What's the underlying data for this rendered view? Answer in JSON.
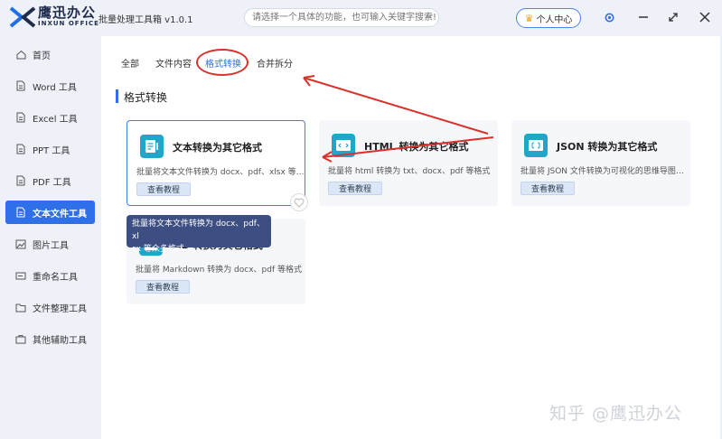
{
  "app": {
    "brand_cn": "鹰迅办公",
    "brand_en": "INXUN OFFICE",
    "title": "批量处理工具箱 v1.0.1"
  },
  "search": {
    "placeholder": "请选择一个具体的功能，也可输入关键字搜索!"
  },
  "header": {
    "user_center": "个人中心"
  },
  "sidebar": {
    "items": [
      {
        "label": "首页",
        "icon": "home-icon"
      },
      {
        "label": "Word 工具",
        "icon": "document-icon"
      },
      {
        "label": "Excel 工具",
        "icon": "document-icon"
      },
      {
        "label": "PPT 工具",
        "icon": "document-icon"
      },
      {
        "label": "PDF 工具",
        "icon": "document-icon"
      },
      {
        "label": "文本文件工具",
        "icon": "document-icon",
        "active": true
      },
      {
        "label": "图片工具",
        "icon": "image-icon"
      },
      {
        "label": "重命名工具",
        "icon": "rename-icon"
      },
      {
        "label": "文件整理工具",
        "icon": "folder-icon"
      },
      {
        "label": "其他辅助工具",
        "icon": "toolbox-icon"
      }
    ]
  },
  "tabs": [
    {
      "label": "全部"
    },
    {
      "label": "文件内容"
    },
    {
      "label": "格式转换",
      "active": true
    },
    {
      "label": "合并拆分"
    }
  ],
  "section": {
    "title": "格式转换"
  },
  "cards": [
    {
      "title": "文本转换为其它格式",
      "desc": "批量将文本文件转换为 docx、pdf、xlsx 等…",
      "button": "查看教程"
    },
    {
      "title": "HTML 转换为其它格式",
      "desc": "批量将 html 转换为 txt、docx、pdf 等格式",
      "button": "查看教程"
    },
    {
      "title": "JSON 转换为其它格式",
      "desc": "批量将 JSON 文件转换为可视化的思维导图…",
      "button": "查看教程"
    },
    {
      "title": "MD 转换为其它格式",
      "desc": "批量将 Markdown 转换为 docx、pdf 等格式",
      "button": "查看教程"
    }
  ],
  "tooltip": {
    "line1": "批量将文本文件转换为 docx、pdf、xl",
    "line2": "sx 等众多格式"
  },
  "watermark": "知乎 @鹰迅办公",
  "colors": {
    "accent": "#2f6fe8",
    "annotation": "#d9322b",
    "card_icon": "#1fa6c8",
    "tooltip_bg": "#3d4f82"
  }
}
